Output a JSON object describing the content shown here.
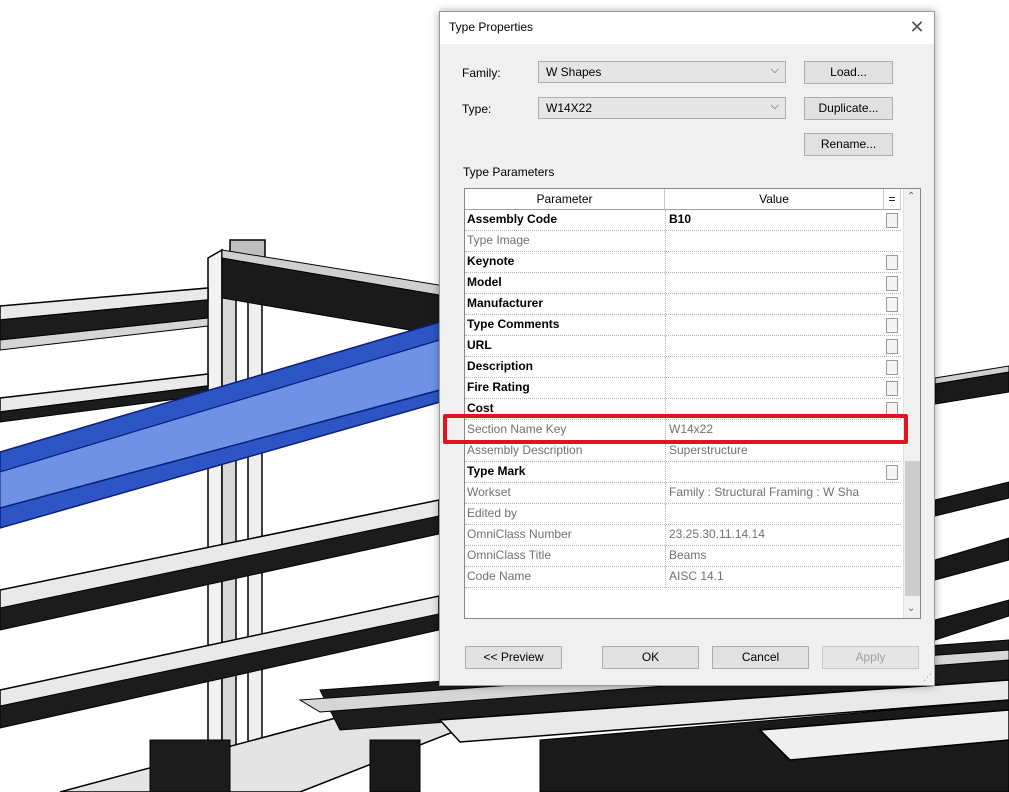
{
  "dialog": {
    "title": "Type Properties",
    "family_label": "Family:",
    "family_value": "W Shapes",
    "type_label": "Type:",
    "type_value": "W14X22",
    "load_label": "Load...",
    "duplicate_label": "Duplicate...",
    "rename_label": "Rename...",
    "type_parameters_label": "Type Parameters",
    "columns": {
      "parameter": "Parameter",
      "value": "Value",
      "eq": "="
    },
    "rows": [
      {
        "param": "Assembly Code",
        "value": "B10",
        "editable": true
      },
      {
        "param": "Type Image",
        "value": "",
        "editable": false
      },
      {
        "param": "Keynote",
        "value": "",
        "editable": true
      },
      {
        "param": "Model",
        "value": "",
        "editable": true
      },
      {
        "param": "Manufacturer",
        "value": "",
        "editable": true
      },
      {
        "param": "Type Comments",
        "value": "",
        "editable": true
      },
      {
        "param": "URL",
        "value": "",
        "editable": true
      },
      {
        "param": "Description",
        "value": "",
        "editable": true
      },
      {
        "param": "Fire Rating",
        "value": "",
        "editable": true
      },
      {
        "param": "Cost",
        "value": "",
        "editable": true
      },
      {
        "param": "Section Name Key",
        "value": "W14x22",
        "editable": false
      },
      {
        "param": "Assembly Description",
        "value": "Superstructure",
        "editable": false
      },
      {
        "param": "Type Mark",
        "value": "",
        "editable": true
      },
      {
        "param": "Workset",
        "value": "Family : Structural Framing : W Sha",
        "editable": false
      },
      {
        "param": "Edited by",
        "value": "",
        "editable": false
      },
      {
        "param": "OmniClass Number",
        "value": "23.25.30.11.14.14",
        "editable": false
      },
      {
        "param": "OmniClass Title",
        "value": "Beams",
        "editable": false
      },
      {
        "param": "Code Name",
        "value": "AISC 14.1",
        "editable": false
      }
    ],
    "preview_label": "<< Preview",
    "ok_label": "OK",
    "cancel_label": "Cancel",
    "apply_label": "Apply"
  },
  "colors": {
    "highlight": "#e0141e",
    "beam_selected": "#4a72d6",
    "steel_dark": "#1e1e1e",
    "steel_light": "#e6e6e6"
  }
}
